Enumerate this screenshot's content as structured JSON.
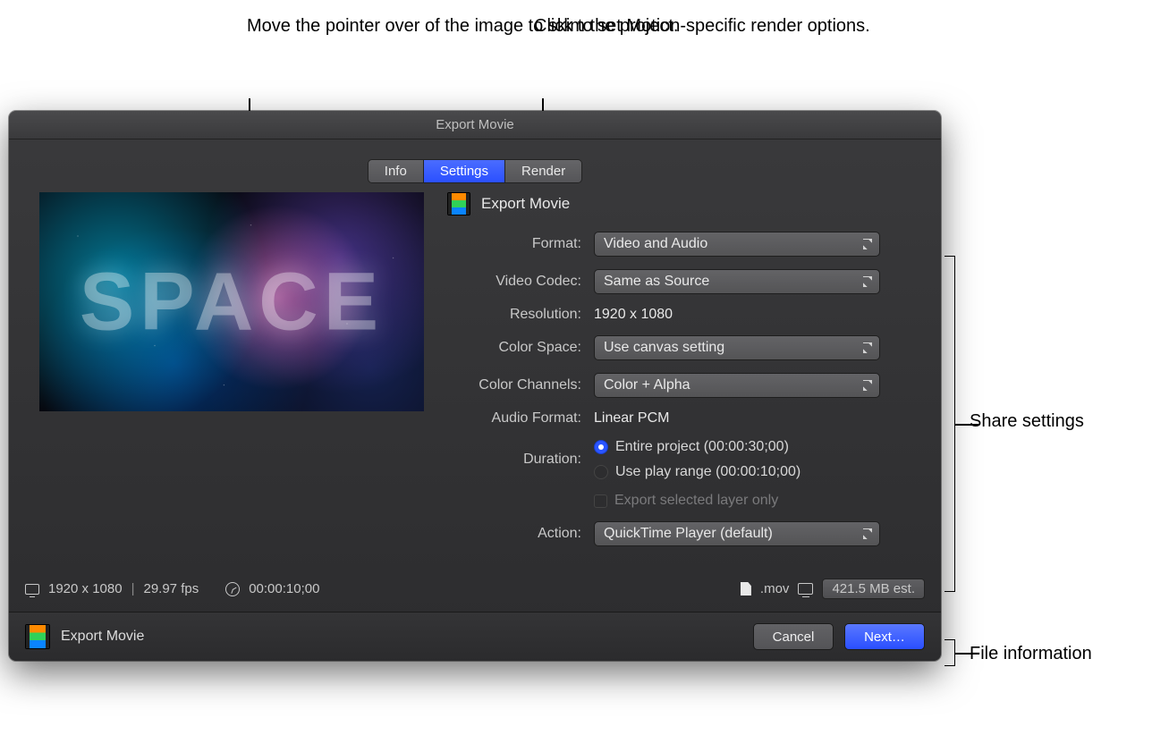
{
  "annotations": {
    "skim": "Move the pointer over of the image to skim the project.",
    "render": "Click to set Motion-specific render options.",
    "share": "Share settings",
    "fileinfo": "File information"
  },
  "dialog": {
    "title": "Export Movie",
    "tabs": {
      "info": "Info",
      "settings": "Settings",
      "render": "Render"
    },
    "header_title": "Export Movie",
    "preview_text": "SPACE"
  },
  "settings": {
    "format": {
      "label": "Format:",
      "value": "Video and Audio"
    },
    "codec": {
      "label": "Video Codec:",
      "value": "Same as Source"
    },
    "resolution": {
      "label": "Resolution:",
      "value": "1920 x 1080"
    },
    "colorspace": {
      "label": "Color Space:",
      "value": "Use canvas setting"
    },
    "channels": {
      "label": "Color Channels:",
      "value": "Color + Alpha"
    },
    "audio": {
      "label": "Audio Format:",
      "value": "Linear PCM"
    },
    "duration": {
      "label": "Duration:",
      "entire": "Entire project (00:00:30;00)",
      "range": "Use play range (00:00:10;00)"
    },
    "export_selected": "Export selected layer only",
    "action": {
      "label": "Action:",
      "value": "QuickTime Player (default)"
    }
  },
  "status": {
    "dims": "1920 x 1080",
    "fps": "29.97 fps",
    "timecode": "00:00:10;00",
    "ext": ".mov",
    "size": "421.5 MB est."
  },
  "footer": {
    "title": "Export Movie",
    "cancel": "Cancel",
    "next": "Next…"
  }
}
